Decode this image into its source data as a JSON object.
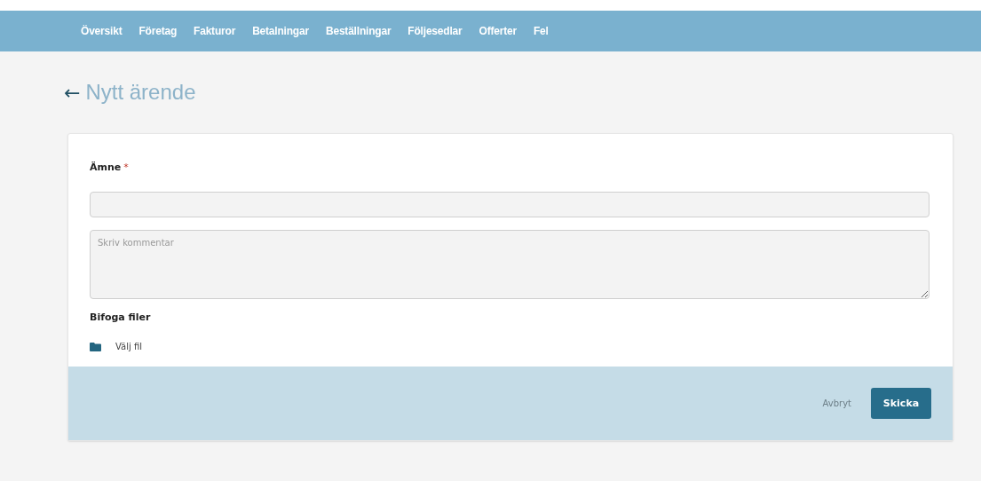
{
  "nav": {
    "items": [
      "Översikt",
      "Företag",
      "Fakturor",
      "Betalningar",
      "Beställningar",
      "Följesedlar",
      "Offerter",
      "Fel"
    ]
  },
  "page": {
    "back": "←",
    "title": "Nytt ärende"
  },
  "form": {
    "subject_label": "Ämne",
    "required_mark": "*",
    "comment_placeholder": "Skriv kommentar",
    "attach_label": "Bifoga filer",
    "file_button": "Välj fil"
  },
  "footer": {
    "cancel": "Avbryt",
    "submit": "Skicka"
  }
}
